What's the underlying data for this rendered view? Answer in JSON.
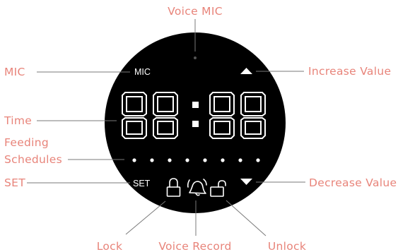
{
  "labels": {
    "voice_mic": "Voice MIC",
    "mic": "MIC",
    "increase_value": "Increase Value",
    "time": "Time",
    "feeding_schedules_line1": "Feeding",
    "feeding_schedules_line2": "Schedules",
    "set": "SET",
    "decrease_value": "Decrease Value",
    "lock": "Lock",
    "voice_record": "Voice Record",
    "unlock": "Unlock"
  },
  "panel": {
    "mic_text": "MIC",
    "set_text": "SET",
    "display_digits": "88:88",
    "schedule_dot_count": 8
  },
  "colors": {
    "label": "#e8847a",
    "leader_line": "#7a7a7a",
    "panel_background": "#000000",
    "panel_foreground": "#ffffff"
  },
  "icons": {
    "increase": "triangle-up-icon",
    "decrease": "triangle-down-icon",
    "lock": "lock-closed-icon",
    "voice_record": "bell-sound-icon",
    "unlock": "lock-open-icon",
    "mic_hole": "mic-hole-icon"
  }
}
